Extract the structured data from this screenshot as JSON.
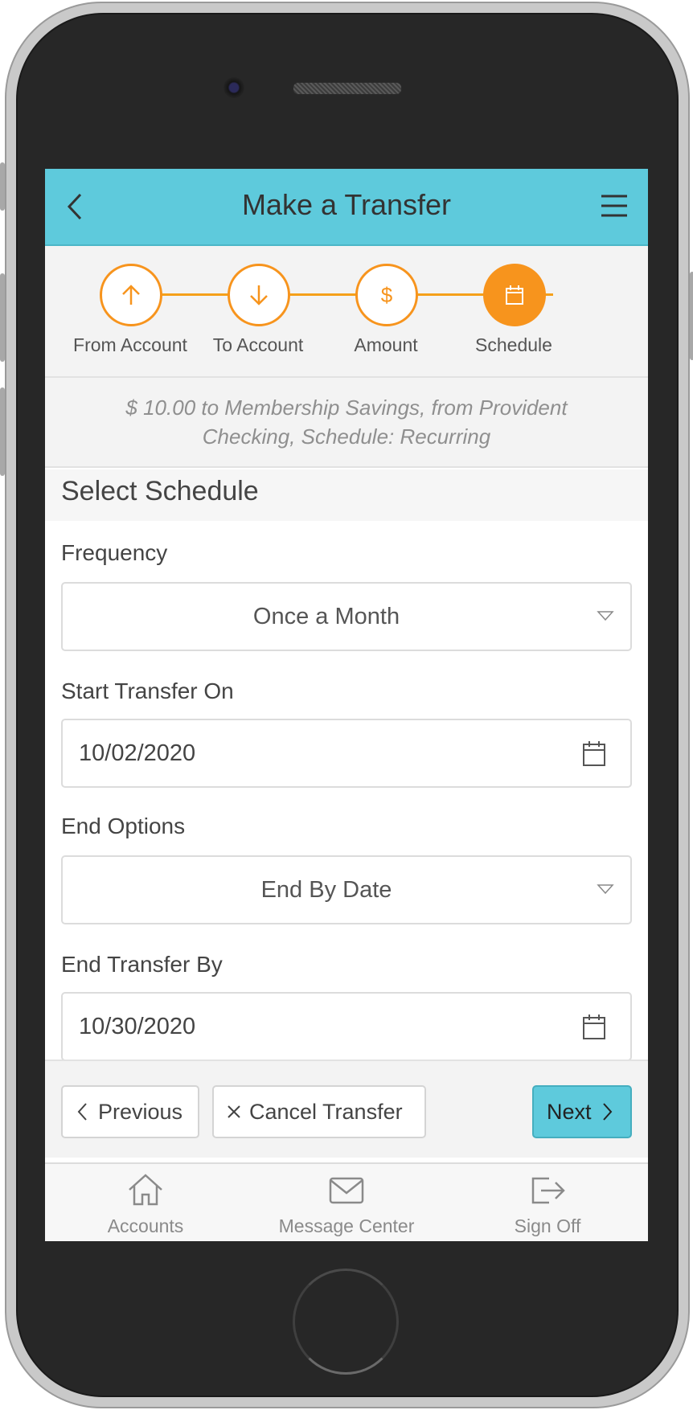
{
  "header": {
    "title": "Make a Transfer"
  },
  "steps": [
    {
      "label": "From Account",
      "icon": "arrow-up-icon",
      "active": false
    },
    {
      "label": "To Account",
      "icon": "arrow-down-icon",
      "active": false
    },
    {
      "label": "Amount",
      "icon": "dollar-icon",
      "active": false
    },
    {
      "label": "Schedule",
      "icon": "calendar-icon",
      "active": true
    }
  ],
  "summary": "$ 10.00 to Membership Savings, from Provident Checking, Schedule: Recurring",
  "section_title": "Select Schedule",
  "form": {
    "frequency": {
      "label": "Frequency",
      "value": "Once a Month"
    },
    "start": {
      "label": "Start Transfer On",
      "value": "10/02/2020"
    },
    "end_options": {
      "label": "End Options",
      "value": "End By Date"
    },
    "end_by": {
      "label": "End Transfer By",
      "value": "10/30/2020"
    }
  },
  "actions": {
    "previous": "Previous",
    "cancel": "Cancel Transfer",
    "next": "Next"
  },
  "tabbar": [
    {
      "label": "Accounts",
      "icon": "home-icon"
    },
    {
      "label": "Message Center",
      "icon": "mail-icon"
    },
    {
      "label": "Sign Off",
      "icon": "sign-out-icon"
    }
  ],
  "colors": {
    "header": "#5ecadc",
    "accent": "#f7941d",
    "primary_button": "#5ecadc"
  }
}
